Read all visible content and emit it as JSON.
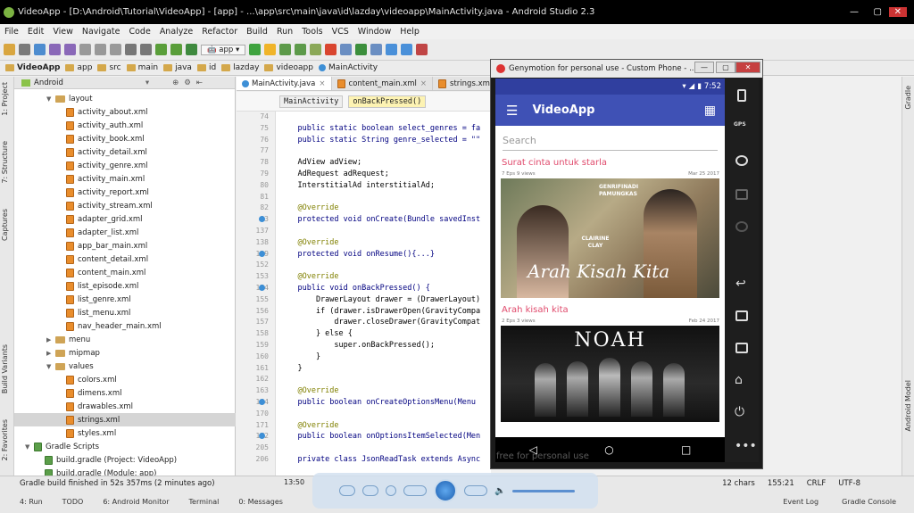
{
  "window": {
    "title": "VideoApp - [D:\\Android\\Tutorial\\VideoApp] - [app] - ...\\app\\src\\main\\java\\id\\lazday\\videoapp\\MainActivity.java - Android Studio 2.3"
  },
  "menu": [
    "File",
    "Edit",
    "View",
    "Navigate",
    "Code",
    "Analyze",
    "Refactor",
    "Build",
    "Run",
    "Tools",
    "VCS",
    "Window",
    "Help"
  ],
  "toolbar": {
    "run_config": "app"
  },
  "nav_crumbs": [
    "VideoApp",
    "app",
    "src",
    "main",
    "java",
    "id",
    "lazday",
    "videoapp",
    "MainActivity"
  ],
  "side_tabs_left": [
    "1: Project",
    "7: Structure",
    "Captures",
    "Build Variants",
    "2: Favorites"
  ],
  "side_tabs_right": [
    "Gradle",
    "Android Model"
  ],
  "project": {
    "view": "Android",
    "tree": [
      {
        "label": "layout",
        "type": "folder",
        "indent": 3,
        "arrow": "▼"
      },
      {
        "label": "activity_about.xml",
        "type": "xml",
        "indent": 4
      },
      {
        "label": "activity_auth.xml",
        "type": "xml",
        "indent": 4
      },
      {
        "label": "activity_book.xml",
        "type": "xml",
        "indent": 4
      },
      {
        "label": "activity_detail.xml",
        "type": "xml",
        "indent": 4
      },
      {
        "label": "activity_genre.xml",
        "type": "xml",
        "indent": 4
      },
      {
        "label": "activity_main.xml",
        "type": "xml",
        "indent": 4
      },
      {
        "label": "activity_report.xml",
        "type": "xml",
        "indent": 4
      },
      {
        "label": "activity_stream.xml",
        "type": "xml",
        "indent": 4
      },
      {
        "label": "adapter_grid.xml",
        "type": "xml",
        "indent": 4
      },
      {
        "label": "adapter_list.xml",
        "type": "xml",
        "indent": 4
      },
      {
        "label": "app_bar_main.xml",
        "type": "xml",
        "indent": 4
      },
      {
        "label": "content_detail.xml",
        "type": "xml",
        "indent": 4
      },
      {
        "label": "content_main.xml",
        "type": "xml",
        "indent": 4
      },
      {
        "label": "list_episode.xml",
        "type": "xml",
        "indent": 4
      },
      {
        "label": "list_genre.xml",
        "type": "xml",
        "indent": 4
      },
      {
        "label": "list_menu.xml",
        "type": "xml",
        "indent": 4
      },
      {
        "label": "nav_header_main.xml",
        "type": "xml",
        "indent": 4
      },
      {
        "label": "menu",
        "type": "folder",
        "indent": 3,
        "arrow": "▶"
      },
      {
        "label": "mipmap",
        "type": "folder",
        "indent": 3,
        "arrow": "▶"
      },
      {
        "label": "values",
        "type": "folder",
        "indent": 3,
        "arrow": "▼"
      },
      {
        "label": "colors.xml",
        "type": "xml",
        "indent": 4
      },
      {
        "label": "dimens.xml",
        "type": "xml",
        "indent": 4
      },
      {
        "label": "drawables.xml",
        "type": "xml",
        "indent": 4
      },
      {
        "label": "strings.xml",
        "type": "xml",
        "indent": 4,
        "selected": true
      },
      {
        "label": "styles.xml",
        "type": "xml",
        "indent": 4
      },
      {
        "label": "Gradle Scripts",
        "type": "gradle",
        "indent": 1,
        "arrow": "▼"
      },
      {
        "label": "build.gradle (Project: VideoApp)",
        "type": "gradle",
        "indent": 2
      },
      {
        "label": "build.gradle (Module: app)",
        "type": "gradle",
        "indent": 2
      }
    ]
  },
  "editor_tabs": [
    "MainActivity.java",
    "content_main.xml",
    "strings.xml"
  ],
  "breadcrumb_pills": [
    "MainActivity",
    "onBackPressed()"
  ],
  "code_lines": [
    {
      "n": "74",
      "t": ""
    },
    {
      "n": "75",
      "t": "    public static boolean select_genres = fa"
    },
    {
      "n": "76",
      "t": "    public static String genre_selected = \"\""
    },
    {
      "n": "77",
      "t": ""
    },
    {
      "n": "78",
      "t": "    AdView adView;"
    },
    {
      "n": "79",
      "t": "    AdRequest adRequest;"
    },
    {
      "n": "80",
      "t": "    InterstitialAd interstitialAd;"
    },
    {
      "n": "81",
      "t": ""
    },
    {
      "n": "82",
      "t": "    @Override"
    },
    {
      "n": "83",
      "t": "    protected void onCreate(Bundle savedInst"
    },
    {
      "n": "137",
      "t": ""
    },
    {
      "n": "138",
      "t": "    @Override"
    },
    {
      "n": "139",
      "t": "    protected void onResume(){...}"
    },
    {
      "n": "152",
      "t": ""
    },
    {
      "n": "153",
      "t": "    @Override"
    },
    {
      "n": "154",
      "t": "    public void onBackPressed() {"
    },
    {
      "n": "155",
      "t": "        DrawerLayout drawer = (DrawerLayout)"
    },
    {
      "n": "156",
      "t": "        if (drawer.isDrawerOpen(GravityCompa"
    },
    {
      "n": "157",
      "t": "            drawer.closeDrawer(GravityCompat"
    },
    {
      "n": "158",
      "t": "        } else {"
    },
    {
      "n": "159",
      "t": "            super.onBackPressed();"
    },
    {
      "n": "160",
      "t": "        }"
    },
    {
      "n": "161",
      "t": "    }"
    },
    {
      "n": "162",
      "t": ""
    },
    {
      "n": "163",
      "t": "    @Override"
    },
    {
      "n": "164",
      "t": "    public boolean onCreateOptionsMenu(Menu"
    },
    {
      "n": "170",
      "t": ""
    },
    {
      "n": "171",
      "t": "    @Override"
    },
    {
      "n": "172",
      "t": "    public boolean onOptionsItemSelected(Men"
    },
    {
      "n": "205",
      "t": ""
    },
    {
      "n": "206",
      "t": "    private class JsonReadTask extends Async"
    }
  ],
  "emulator": {
    "title": "Genymotion for personal use - Custom Phone - ...",
    "time": "7:52",
    "watermark": "free for personal use",
    "app_title": "VideoApp",
    "search_placeholder": "Search",
    "cards": [
      {
        "title": "Surat cinta untuk starla",
        "meta_left": "7 Eps 9 views",
        "meta_right": "Mar 25 2017",
        "overlay_top": "GENRIFINADI PAMUNGKAS",
        "overlay_mid": "CLAIRINE CLAY",
        "overlay_script": "Arah Kisah Kita"
      },
      {
        "title": "Arah kisah kita",
        "meta_left": "2 Eps 3 views",
        "meta_right": "Feb 24 2017",
        "overlay_top": "NOAH"
      }
    ],
    "side_icons": [
      "GPS"
    ]
  },
  "status_bar": {
    "message": "Gradle build finished in 52s 357ms (2 minutes ago)",
    "chars": "12 chars",
    "position": "155:21",
    "line_sep": "CRLF",
    "encoding": "UTF-8"
  },
  "bottom_tools": [
    "4: Run",
    "TODO",
    "6: Android Monitor",
    "Terminal",
    "0: Messages",
    "Event Log",
    "Gradle Console"
  ],
  "player": {
    "time": "13:50"
  }
}
